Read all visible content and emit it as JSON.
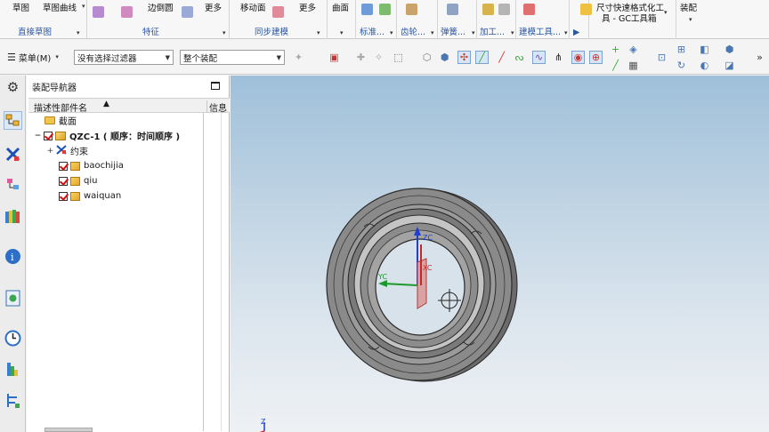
{
  "ribbon": {
    "groups": [
      {
        "top": "草图",
        "bottom": "直接草图"
      },
      {
        "top": "草图曲线"
      },
      {
        "top": "边倒圆"
      },
      {
        "top": "更多",
        "bottom": "特征"
      },
      {
        "top": "移动面"
      },
      {
        "top": "更多",
        "bottom": "同步建模"
      },
      {
        "top": "曲面"
      },
      {
        "bottom": "标准..."
      },
      {
        "bottom": "齿轮..."
      },
      {
        "bottom": "弹簧..."
      },
      {
        "bottom": "加工..."
      },
      {
        "bottom": "建模工具..."
      },
      {
        "bottom": "▶"
      },
      {
        "top": "尺寸快速格式化工",
        "top2": "具 - GC工具箱"
      },
      {
        "top": "装配"
      }
    ]
  },
  "cmdbar": {
    "menu_label": "菜单(M)",
    "selection_filter": "没有选择过滤器",
    "scope": "整个装配"
  },
  "navigator": {
    "title": "装配导航器",
    "col_name": "描述性部件名",
    "col_info": "信息",
    "rows": [
      {
        "label": "截面",
        "type": "folder"
      },
      {
        "label": "QZC-1 ( 顺序：时间顺序 )",
        "type": "assembly"
      },
      {
        "label": "约束",
        "type": "constraint"
      },
      {
        "label": "baochijia",
        "type": "part"
      },
      {
        "label": "qiu",
        "type": "part"
      },
      {
        "label": "waiquan",
        "type": "part"
      }
    ]
  },
  "viewport": {
    "axis_y": "YC",
    "axis_z": "ZC",
    "axis_x": "XC",
    "triad_z": "Z"
  },
  "colors": {
    "ribbon_bg": "#f7f7f7",
    "group_label": "#2a55a0",
    "viewport_top": "#9fc0da",
    "viewport_bottom": "#eef1f4",
    "check_red": "#d01010"
  }
}
